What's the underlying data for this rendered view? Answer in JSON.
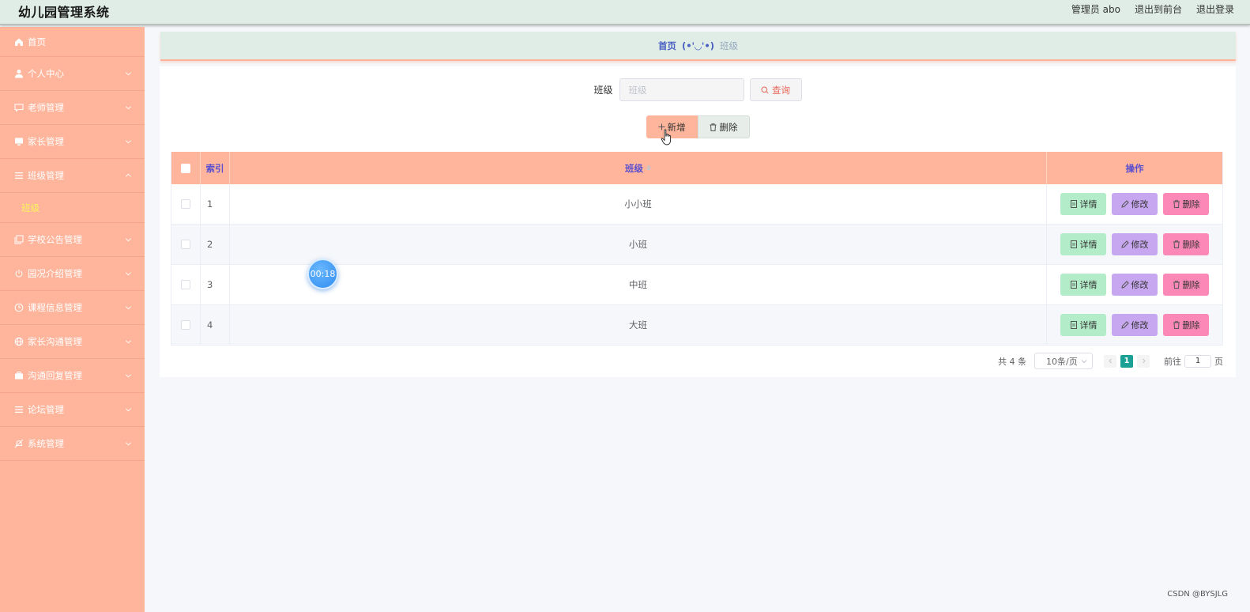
{
  "header": {
    "app_title": "幼儿园管理系统",
    "user_label": "管理员 abo",
    "front_link": "退出到前台",
    "logout_link": "退出登录"
  },
  "sidebar": {
    "items": [
      {
        "label": "首页",
        "icon": "home-icon"
      },
      {
        "label": "个人中心",
        "icon": "user-icon"
      },
      {
        "label": "老师管理",
        "icon": "chat-icon"
      },
      {
        "label": "家长管理",
        "icon": "monitor-icon"
      },
      {
        "label": "班级管理",
        "icon": "list-icon",
        "expanded": true
      },
      {
        "label": "班级",
        "submenu": true,
        "active": true
      },
      {
        "label": "学校公告管理",
        "icon": "copy-icon"
      },
      {
        "label": "园况介绍管理",
        "icon": "power-icon"
      },
      {
        "label": "课程信息管理",
        "icon": "clock-icon"
      },
      {
        "label": "家长沟通管理",
        "icon": "globe-icon"
      },
      {
        "label": "沟通回复管理",
        "icon": "briefcase-icon"
      },
      {
        "label": "论坛管理",
        "icon": "menu-icon"
      },
      {
        "label": "系统管理",
        "icon": "bell-off-icon"
      }
    ]
  },
  "breadcrumb": {
    "home": "首页",
    "separator": "(•'◡'•)",
    "current": "班级"
  },
  "search": {
    "label": "班级",
    "placeholder": "班级",
    "query_button": "查询"
  },
  "actions": {
    "add_button": "新增",
    "delete_button": "删除"
  },
  "table": {
    "headers": {
      "index": "索引",
      "class": "班级",
      "ops": "操作"
    },
    "rows": [
      {
        "index": "1",
        "class": "小小班"
      },
      {
        "index": "2",
        "class": "小班"
      },
      {
        "index": "3",
        "class": "中班"
      },
      {
        "index": "4",
        "class": "大班"
      }
    ],
    "row_actions": {
      "detail": "详情",
      "edit": "修改",
      "delete": "删除"
    }
  },
  "pagination": {
    "total": "共 4 条",
    "page_size": "10条/页",
    "current_page": "1",
    "goto_prefix": "前往",
    "goto_value": "1",
    "goto_suffix": "页"
  },
  "overlay": {
    "timer": "00:18"
  },
  "watermark": "CSDN @BYSJLG",
  "colors": {
    "sidebar": "#ffb59c",
    "header": "#dfede6",
    "accent_text": "#5a4fd0",
    "detail": "#b2ecc8",
    "edit": "#c7a7ef",
    "delete": "#fb88b7",
    "page_active": "#1aa094"
  }
}
